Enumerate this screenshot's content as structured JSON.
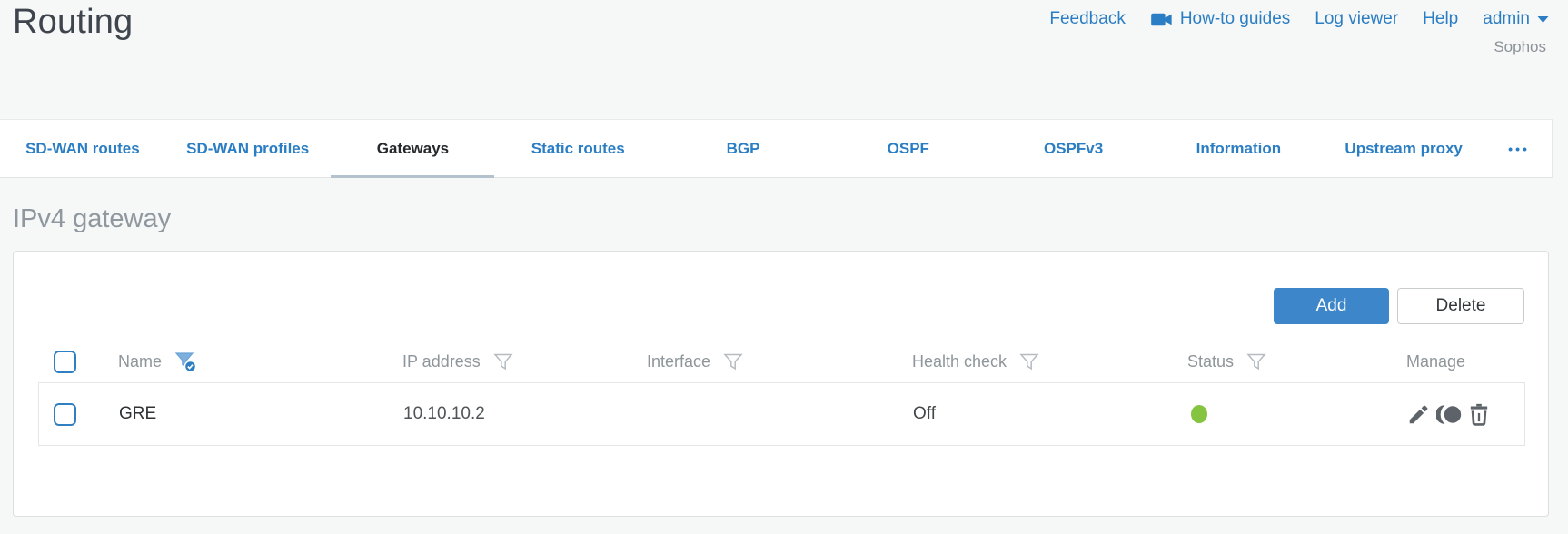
{
  "app": {
    "title": "Routing",
    "brand": "Sophos"
  },
  "header": {
    "links": [
      {
        "label": "Feedback"
      },
      {
        "label": "How-to guides",
        "icon": "video-camera-icon"
      },
      {
        "label": "Log viewer"
      },
      {
        "label": "Help"
      },
      {
        "label": "admin",
        "icon": "caret-down-icon"
      }
    ]
  },
  "tabs": {
    "items": [
      "SD-WAN routes",
      "SD-WAN profiles",
      "Gateways",
      "Static routes",
      "BGP",
      "OSPF",
      "OSPFv3",
      "Information",
      "Upstream proxy"
    ],
    "active": "Gateways",
    "more_label": "•••"
  },
  "section": {
    "heading": "IPv4 gateway"
  },
  "toolbar": {
    "add": "Add",
    "delete": "Delete"
  },
  "table": {
    "columns": [
      {
        "label": "Name",
        "filter": "active"
      },
      {
        "label": "IP address",
        "filter": "inactive"
      },
      {
        "label": "Interface",
        "filter": "inactive"
      },
      {
        "label": "Health check",
        "filter": "inactive"
      },
      {
        "label": "Status",
        "filter": "inactive"
      },
      {
        "label": "Manage",
        "filter": "none"
      }
    ],
    "rows": [
      {
        "name": "GRE",
        "ip_address": "10.10.10.2",
        "interface": "",
        "health_check": "Off",
        "status": "up"
      }
    ]
  },
  "colors": {
    "accent_blue": "#2b7ec3",
    "button_blue": "#3c86c9",
    "status_green": "#85c441",
    "active_tab_underline": "#b3c2cd",
    "filter_active_blue": "#7fb0dd"
  }
}
